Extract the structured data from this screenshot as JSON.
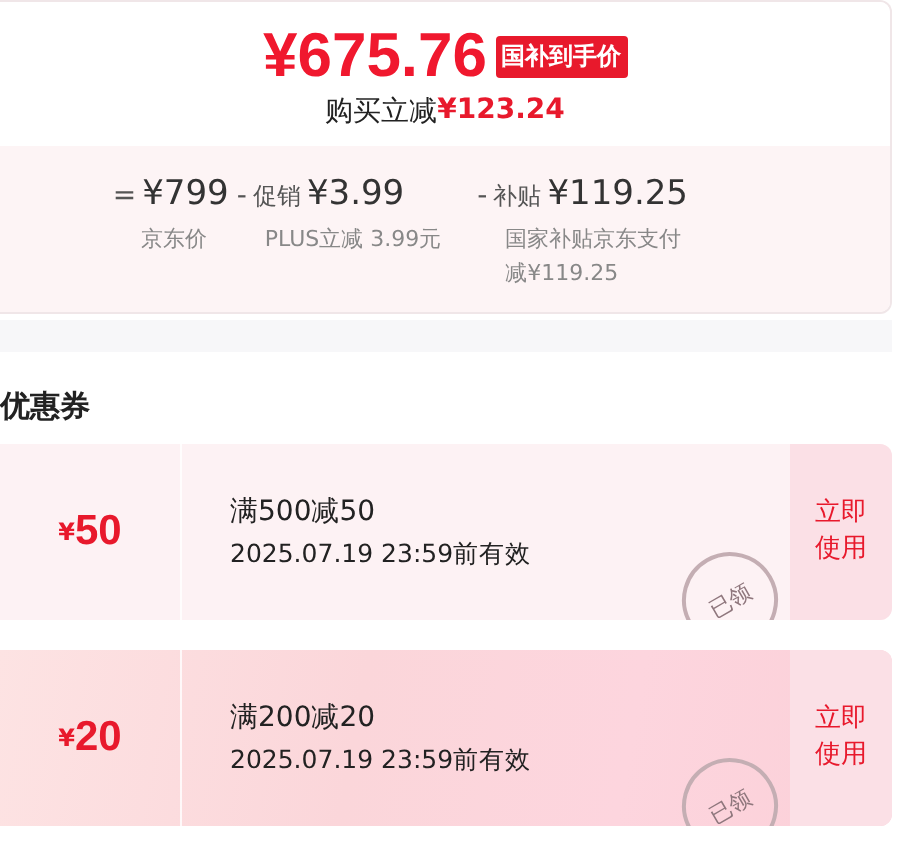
{
  "price_card": {
    "price": "¥675.76",
    "badge": "国补到手价",
    "saving_label": "购买立减",
    "saving_amount": "¥123.24",
    "breakdown": [
      {
        "operator": "=",
        "amount": "¥799",
        "note": "京东价"
      },
      {
        "operator": "-",
        "label": "促销",
        "amount": "¥3.99",
        "note": "PLUS立减 3.99元"
      },
      {
        "operator": "-",
        "label": "补贴",
        "amount": "¥119.25",
        "note": "国家补贴京东支付减¥119.25"
      }
    ]
  },
  "coupons_section": {
    "title": "优惠券",
    "coupons": [
      {
        "kind": "plain",
        "currency": "¥",
        "value": "50",
        "condition": "满500减50",
        "validity": "2025.07.19 23:59前有效",
        "stamp": "已领",
        "action": "立即使用"
      },
      {
        "kind": "gradient",
        "currency": "¥",
        "value": "20",
        "condition": "满200减20",
        "validity": "2025.07.19 23:59前有效",
        "stamp": "已领",
        "action": "立即使用"
      }
    ]
  }
}
